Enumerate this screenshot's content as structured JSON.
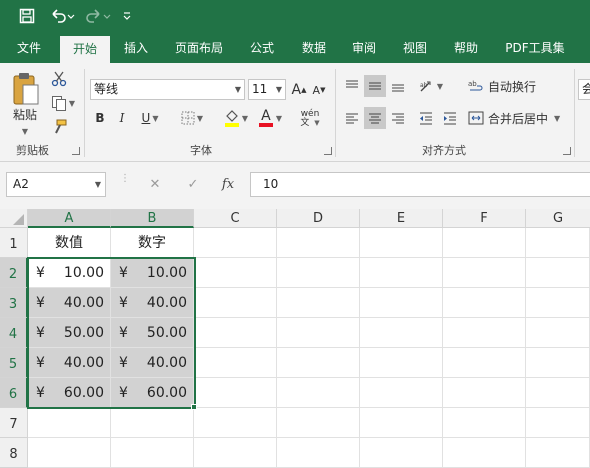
{
  "quick_access": {
    "save_icon": "save-icon",
    "undo_icon": "undo-icon",
    "redo_icon": "redo-icon",
    "customize_icon": "customize-icon"
  },
  "tabs": [
    "文件",
    "开始",
    "插入",
    "页面布局",
    "公式",
    "数据",
    "审阅",
    "视图",
    "帮助",
    "PDF工具集"
  ],
  "active_tab": "开始",
  "ribbon": {
    "clipboard": {
      "paste_label": "粘贴",
      "group_label": "剪贴板"
    },
    "font": {
      "font_name": "等线",
      "font_size": "11",
      "increase_font": "A",
      "decrease_font": "A",
      "bold": "B",
      "italic": "I",
      "underline": "U",
      "font_color_letter": "A",
      "phonetic_label": "wén",
      "group_label": "字体"
    },
    "alignment": {
      "wrap_text": "自动换行",
      "merge_center": "合并后居中",
      "group_label": "对齐方式"
    },
    "number_partial": "会"
  },
  "formula_bar": {
    "name_box": "A2",
    "cancel": "✕",
    "enter": "✓",
    "fx": "fx",
    "content": "10"
  },
  "grid": {
    "columns": [
      "A",
      "B",
      "C",
      "D",
      "E",
      "F",
      "G"
    ],
    "rows": [
      "1",
      "2",
      "3",
      "4",
      "5",
      "6",
      "7",
      "8"
    ],
    "headers": [
      "数值",
      "数字"
    ],
    "currency_symbol": "¥",
    "data": [
      [
        "10.00",
        "10.00"
      ],
      [
        "40.00",
        "40.00"
      ],
      [
        "50.00",
        "50.00"
      ],
      [
        "40.00",
        "40.00"
      ],
      [
        "60.00",
        "60.00"
      ]
    ]
  },
  "colors": {
    "accent": "#217346",
    "selection_fill": "#d2d2d2",
    "font_color_bar": "#e81123",
    "highlight_bar": "#ffff00"
  }
}
